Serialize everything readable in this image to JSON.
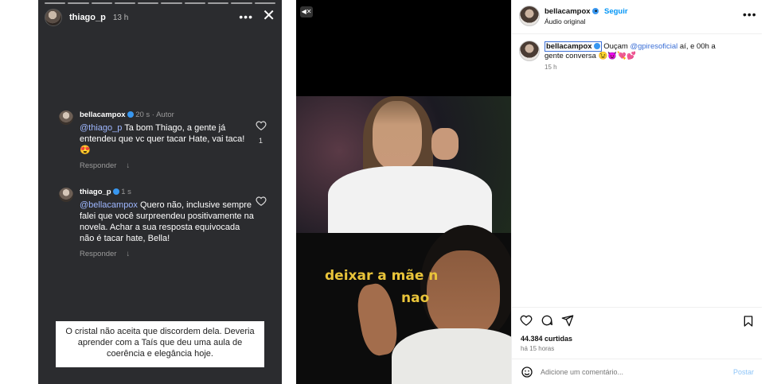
{
  "story": {
    "username": "thiago_p",
    "time": "13 h",
    "more_icon": "more-horizontal-icon",
    "close_icon": "close-icon",
    "comments": [
      {
        "username": "bellacampox",
        "meta": "20 s · Autor",
        "mention": "@thiago_p",
        "text": " Ta bom Thiago, a gente já entendeu que vc quer tacar Hate, vai taca! 😍",
        "reply": "Responder",
        "like_count": "1"
      },
      {
        "username": "thiago_p",
        "meta": "1 s",
        "mention": "@bellacampox",
        "text": " Quero não, inclusive sempre falei que você surpreendeu positivamente na novela. Achar a sua resposta equivocada não é tacar hate, Bella!",
        "reply": "Responder",
        "like_count": ""
      }
    ],
    "caption": "O cristal não aceita que discordem dela. Deveria aprender com a Taís que deu uma aula de coerência e elegância hoje."
  },
  "video": {
    "mute_icon": "muted-speaker-icon",
    "overlay_text_1": "deixar a mãe n",
    "overlay_text_2": "nao"
  },
  "post": {
    "username": "bellacampox",
    "dot": "•",
    "follow_label": "Seguir",
    "audio": "Áudio original",
    "comment": {
      "username": "bellacampox",
      "text_before": " Ouçam ",
      "mention": "@gpiresoficial",
      "text_after": " aí, e 00h a gente conversa 😉😈💘💕",
      "time": "15 h"
    },
    "likes": "44.384 curtidas",
    "ago": "há 15 horas",
    "add_comment_placeholder": "Adicione um comentário...",
    "post_label": "Postar"
  },
  "colors": {
    "story_bg": "#2b2c2f",
    "verified": "#3897f0",
    "link_blue": "#0095f6",
    "mention_blue": "#3b6fd6",
    "overlay_yellow": "#e9c43a"
  }
}
